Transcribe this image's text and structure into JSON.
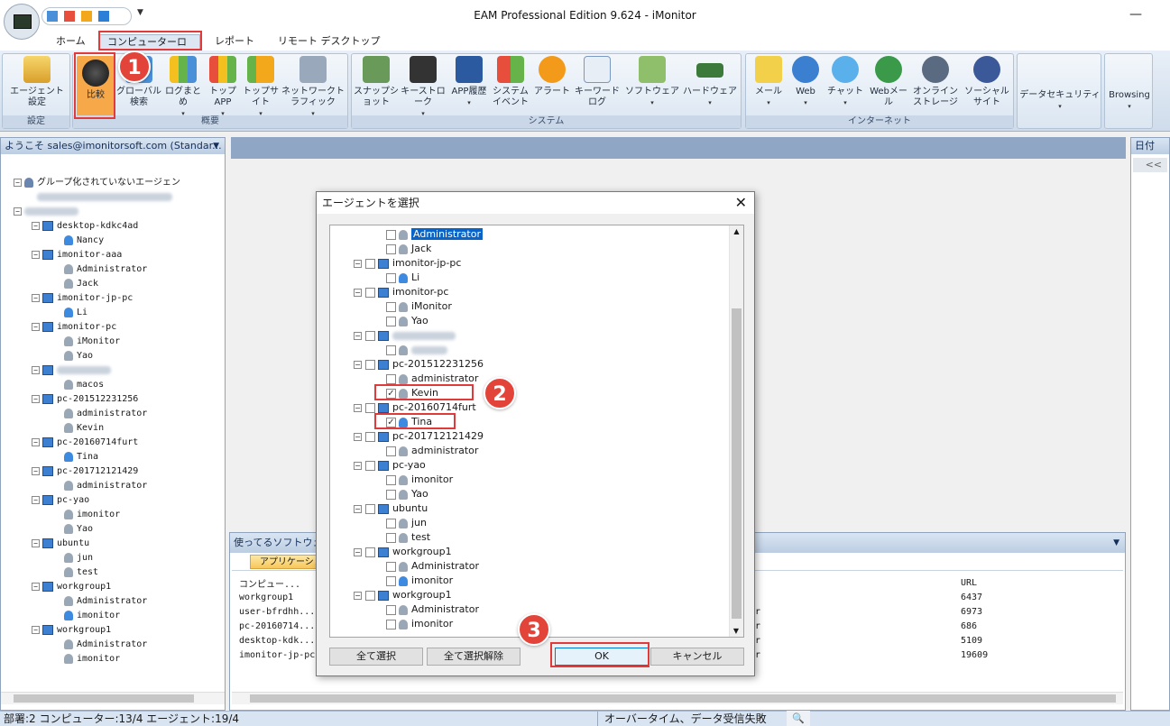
{
  "window": {
    "title": "EAM Professional Edition 9.624 - iMonitor",
    "minimize": "—"
  },
  "tabs": [
    "ホーム",
    "コンピューターログ",
    "レポート",
    "リモート デスクトップ"
  ],
  "ribbon": {
    "settings_group": {
      "label": "設定",
      "buttons": [
        {
          "label": "エージェント設定"
        }
      ]
    },
    "overview_group": {
      "label": "概要",
      "buttons": [
        {
          "label": "比較"
        },
        {
          "label": "グローバル検索"
        },
        {
          "label": "ログまとめ"
        },
        {
          "label": "トップAPP"
        },
        {
          "label": "トップサイト"
        },
        {
          "label": "ネットワークトラフィック"
        }
      ]
    },
    "system_group": {
      "label": "システム",
      "buttons": [
        {
          "label": "スナップショット"
        },
        {
          "label": "キーストローク"
        },
        {
          "label": "APP履歴"
        },
        {
          "label": "システムイベント"
        },
        {
          "label": "アラート"
        },
        {
          "label": "キーワードログ"
        },
        {
          "label": "ソフトウェア"
        },
        {
          "label": "ハードウェア"
        }
      ]
    },
    "internet_group": {
      "label": "インターネット",
      "buttons": [
        {
          "label": "メール"
        },
        {
          "label": "Web"
        },
        {
          "label": "チャット"
        },
        {
          "label": "Webメール"
        },
        {
          "label": "オンラインストレージ"
        },
        {
          "label": "ソーシャルサイト"
        }
      ]
    },
    "data_security": "データセキュリティ",
    "browsing": "Browsing"
  },
  "left_panel": {
    "header": "ようこそ sales@imonitorsoft.com (Standar...",
    "ungrouped": "グループ化されていないエージェン",
    "items": [
      {
        "pc": "desktop-kdkc4ad",
        "users": [
          "Nancy"
        ]
      },
      {
        "pc": "imonitor-aaa",
        "users": [
          "Administrator",
          "Jack"
        ]
      },
      {
        "pc": "imonitor-jp-pc",
        "users": [
          "Li"
        ]
      },
      {
        "pc": "imonitor-pc",
        "users": [
          "iMonitor",
          "Yao"
        ]
      },
      {
        "pc": "",
        "users": [
          "macos"
        ]
      },
      {
        "pc": "pc-201512231256",
        "users": [
          "administrator",
          "Kevin"
        ]
      },
      {
        "pc": "pc-20160714furt",
        "users": [
          "Tina"
        ]
      },
      {
        "pc": "pc-201712121429",
        "users": [
          "administrator"
        ]
      },
      {
        "pc": "pc-yao",
        "users": [
          "imonitor",
          "Yao"
        ]
      },
      {
        "pc": "ubuntu",
        "users": [
          "jun",
          "test"
        ]
      },
      {
        "pc": "workgroup1",
        "users": [
          "Administrator",
          "imonitor"
        ]
      },
      {
        "pc": "workgroup1",
        "users": [
          "Administrator",
          "imonitor"
        ]
      }
    ]
  },
  "right_panel": {
    "header": "日付",
    "collapse": "<<"
  },
  "bottom_panel": {
    "header": "使ってるソフトウェア",
    "tab": "アプリケーション",
    "col_computer": "コンピュー...",
    "col_url": "URL",
    "rows": [
      {
        "computer": "workgroup1",
        "mid": "",
        "url": "6437"
      },
      {
        "computer": "user-bfrdhh...",
        "mid": "r",
        "url": "6973"
      },
      {
        "computer": "pc-20160714...",
        "mid": "r",
        "url": "686"
      },
      {
        "computer": "desktop-kdk...",
        "mid": "r",
        "url": "5109"
      },
      {
        "computer": "imonitor-jp-pc",
        "mid": "r",
        "url": "19609"
      }
    ]
  },
  "status": {
    "left": "部署:2 コンピューター:13/4 エージェント:19/4",
    "right": "オーバータイム、データ受信失敗"
  },
  "dialog": {
    "title": "エージェントを選択",
    "close": "✕",
    "rows": [
      {
        "t": "u",
        "label": "Administrator",
        "checked": false,
        "selected": true
      },
      {
        "t": "u",
        "label": "Jack",
        "checked": false
      },
      {
        "t": "pc",
        "label": "imonitor-jp-pc",
        "checked": false
      },
      {
        "t": "u",
        "label": "Li",
        "checked": false,
        "on": true
      },
      {
        "t": "pc",
        "label": "imonitor-pc",
        "checked": false
      },
      {
        "t": "u",
        "label": "iMonitor",
        "checked": false
      },
      {
        "t": "u",
        "label": "Yao",
        "checked": false
      },
      {
        "t": "pc",
        "label": "",
        "checked": false,
        "blur": true
      },
      {
        "t": "u",
        "label": "",
        "checked": false,
        "blur": true
      },
      {
        "t": "pc",
        "label": "pc-201512231256",
        "checked": false
      },
      {
        "t": "u",
        "label": "administrator",
        "checked": false
      },
      {
        "t": "u",
        "label": "Kevin",
        "checked": true
      },
      {
        "t": "pc",
        "label": "pc-20160714furt",
        "checked": false
      },
      {
        "t": "u",
        "label": "Tina",
        "checked": true,
        "on": true
      },
      {
        "t": "pc",
        "label": "pc-201712121429",
        "checked": false
      },
      {
        "t": "u",
        "label": "administrator",
        "checked": false
      },
      {
        "t": "pc",
        "label": "pc-yao",
        "checked": false
      },
      {
        "t": "u",
        "label": "imonitor",
        "checked": false
      },
      {
        "t": "u",
        "label": "Yao",
        "checked": false
      },
      {
        "t": "pc",
        "label": "ubuntu",
        "checked": false
      },
      {
        "t": "u",
        "label": "jun",
        "checked": false
      },
      {
        "t": "u",
        "label": "test",
        "checked": false
      },
      {
        "t": "pc",
        "label": "workgroup1",
        "checked": false
      },
      {
        "t": "u",
        "label": "Administrator",
        "checked": false
      },
      {
        "t": "u",
        "label": "imonitor",
        "checked": false,
        "on": true
      },
      {
        "t": "pc",
        "label": "workgroup1",
        "checked": false
      },
      {
        "t": "u",
        "label": "Administrator",
        "checked": false
      },
      {
        "t": "u",
        "label": "imonitor",
        "checked": false
      }
    ],
    "select_all": "全て選択",
    "deselect_all": "全て選択解除",
    "ok": "OK",
    "cancel": "キャンセル"
  },
  "annotations": [
    "1",
    "2",
    "3"
  ],
  "colors": {
    "accent": "#e03a3a",
    "selected_button": "#f7a94a"
  }
}
